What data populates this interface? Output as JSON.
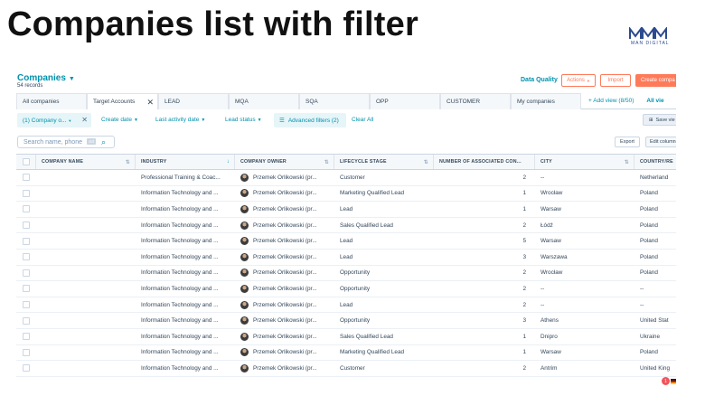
{
  "slide": {
    "title": "Companies list with filter",
    "logo_text": "MAN DIGITAL"
  },
  "header": {
    "object_label": "Companies",
    "record_count": "54 records",
    "data_quality": "Data Quality",
    "actions_label": "Actions",
    "import_label": "Import",
    "create_label": "Create compa"
  },
  "tabs": [
    {
      "label": "All companies"
    },
    {
      "label": "Target Accounts"
    },
    {
      "label": "LEAD"
    },
    {
      "label": "MQA"
    },
    {
      "label": "SQA"
    },
    {
      "label": "OPP"
    },
    {
      "label": "CUSTOMER"
    },
    {
      "label": "My companies"
    }
  ],
  "add_view": "+ Add view (8/50)",
  "all_views": "All vie",
  "filters": {
    "chip": "(1) Company o...",
    "create_date": "Create date",
    "last_activity": "Last activity date",
    "lead_status": "Lead status",
    "advanced": "Advanced filters (2)",
    "clear_all": "Clear All",
    "save_view": "Save vie"
  },
  "search": {
    "placeholder": "Search name, phone",
    "kbd": "ctrl"
  },
  "toolbar": {
    "export": "Export",
    "edit_columns": "Edit column"
  },
  "columns": [
    "COMPANY NAME",
    "INDUSTRY",
    "COMPANY OWNER",
    "LIFECYCLE STAGE",
    "NUMBER OF ASSOCIATED CON...",
    "CITY",
    "COUNTRY/RE"
  ],
  "rows": [
    {
      "industry": "Professional Training & Coac...",
      "owner": "Przemek Orlikowski (pr...",
      "stage": "Customer",
      "contacts": "2",
      "city": "--",
      "country": "Netherland"
    },
    {
      "industry": "Information Technology and ...",
      "owner": "Przemek Orlikowski (pr...",
      "stage": "Marketing Qualified Lead",
      "contacts": "1",
      "city": "Wrocław",
      "country": "Poland"
    },
    {
      "industry": "Information Technology and ...",
      "owner": "Przemek Orlikowski (pr...",
      "stage": "Lead",
      "contacts": "1",
      "city": "Warsaw",
      "country": "Poland"
    },
    {
      "industry": "Information Technology and ...",
      "owner": "Przemek Orlikowski (pr...",
      "stage": "Sales Qualified Lead",
      "contacts": "2",
      "city": "Łódź",
      "country": "Poland"
    },
    {
      "industry": "Information Technology and ...",
      "owner": "Przemek Orlikowski (pr...",
      "stage": "Lead",
      "contacts": "5",
      "city": "Warsaw",
      "country": "Poland"
    },
    {
      "industry": "Information Technology and ...",
      "owner": "Przemek Orlikowski (pr...",
      "stage": "Lead",
      "contacts": "3",
      "city": "Warszawa",
      "country": "Poland"
    },
    {
      "industry": "Information Technology and ...",
      "owner": "Przemek Orlikowski (pr...",
      "stage": "Opportunity",
      "contacts": "2",
      "city": "Wrocław",
      "country": "Poland"
    },
    {
      "industry": "Information Technology and ...",
      "owner": "Przemek Orlikowski (pr...",
      "stage": "Opportunity",
      "contacts": "2",
      "city": "--",
      "country": "--"
    },
    {
      "industry": "Information Technology and ...",
      "owner": "Przemek Orlikowski (pr...",
      "stage": "Lead",
      "contacts": "2",
      "city": "--",
      "country": "--"
    },
    {
      "industry": "Information Technology and ...",
      "owner": "Przemek Orlikowski (pr...",
      "stage": "Opportunity",
      "contacts": "3",
      "city": "Athens",
      "country": "United Stat"
    },
    {
      "industry": "Information Technology and ...",
      "owner": "Przemek Orlikowski (pr...",
      "stage": "Sales Qualified Lead",
      "contacts": "1",
      "city": "Dnipro",
      "country": "Ukraine"
    },
    {
      "industry": "Information Technology and ...",
      "owner": "Przemek Orlikowski (pr...",
      "stage": "Marketing Qualified Lead",
      "contacts": "1",
      "city": "Warsaw",
      "country": "Poland"
    },
    {
      "industry": "Information Technology and ...",
      "owner": "Przemek Orlikowski (pr...",
      "stage": "Customer",
      "contacts": "2",
      "city": "Antrim",
      "country": "United King"
    }
  ],
  "footer": {
    "notification_count": "1"
  },
  "colors": {
    "accent": "#0091ae",
    "orange": "#ff7a59",
    "text": "#33475b"
  }
}
